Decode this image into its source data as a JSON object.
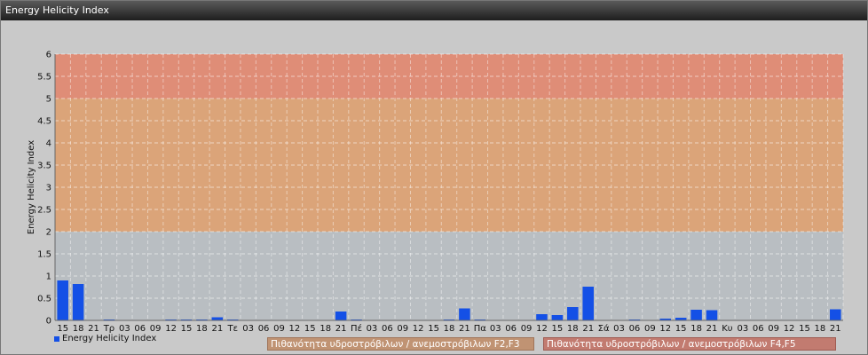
{
  "window": {
    "title": "Energy Helicity Index"
  },
  "legend": {
    "series_label": "Energy Helicity Index"
  },
  "bands": {
    "f23_label": "Πιθανότητα υδροστρόβιλων / ανεμοστρόβιλων F2,F3",
    "f45_label": "Πιθανότητα υδροστρόβιλων / ανεμοστρόβιλων F4,F5"
  },
  "colors": {
    "bar": "#1450e6",
    "band_low": "#b9bec2",
    "band_f23": "#dba479",
    "band_f45": "#df8d77"
  },
  "chart_data": {
    "type": "bar",
    "ylabel": "Energy Helicity Index",
    "xlabel": "",
    "ylim": [
      0,
      6
    ],
    "yticks": [
      "0",
      "0.5",
      "1",
      "1.5",
      "2",
      "2.5",
      "3",
      "3.5",
      "4",
      "4.5",
      "5",
      "5.5",
      "6"
    ],
    "threshold_bands": [
      {
        "from": 0,
        "to": 2,
        "color": "#b9bec2"
      },
      {
        "from": 2,
        "to": 5,
        "color": "#dba479",
        "label": "Πιθανότητα υδροστρόβιλων / ανεμοστρόβιλων F2,F3"
      },
      {
        "from": 5,
        "to": 6,
        "color": "#df8d77",
        "label": "Πιθανότητα υδροστρόβιλων / ανεμοστρόβιλων F4,F5"
      }
    ],
    "categories": [
      "15",
      "18",
      "21",
      "Τρ",
      "03",
      "06",
      "09",
      "12",
      "15",
      "18",
      "21",
      "Τε",
      "03",
      "06",
      "09",
      "12",
      "15",
      "18",
      "21",
      "Πέ",
      "03",
      "06",
      "09",
      "12",
      "15",
      "18",
      "21",
      "Πα",
      "03",
      "06",
      "09",
      "12",
      "15",
      "18",
      "21",
      "Σά",
      "03",
      "06",
      "09",
      "12",
      "15",
      "18",
      "21",
      "Κυ",
      "03",
      "06",
      "09",
      "12",
      "15",
      "18",
      "21"
    ],
    "series": [
      {
        "name": "Energy Helicity Index",
        "values": [
          0.9,
          0.82,
          0.01,
          0.02,
          0.01,
          0.01,
          0.01,
          0.02,
          0.02,
          0.02,
          0.07,
          0.02,
          0.01,
          0.01,
          0.01,
          0.01,
          0.01,
          0.01,
          0.2,
          0.02,
          0.01,
          0.01,
          0.01,
          0.01,
          0.01,
          0.02,
          0.27,
          0.02,
          0.01,
          0.01,
          0.01,
          0.14,
          0.12,
          0.3,
          0.76,
          0.01,
          0.01,
          0.02,
          0.01,
          0.04,
          0.06,
          0.24,
          0.23,
          0.01,
          0.01,
          0.01,
          0.01,
          0.01,
          0.01,
          0.01,
          0.25
        ]
      }
    ],
    "grid": true,
    "legend_position": "bottom-left"
  }
}
